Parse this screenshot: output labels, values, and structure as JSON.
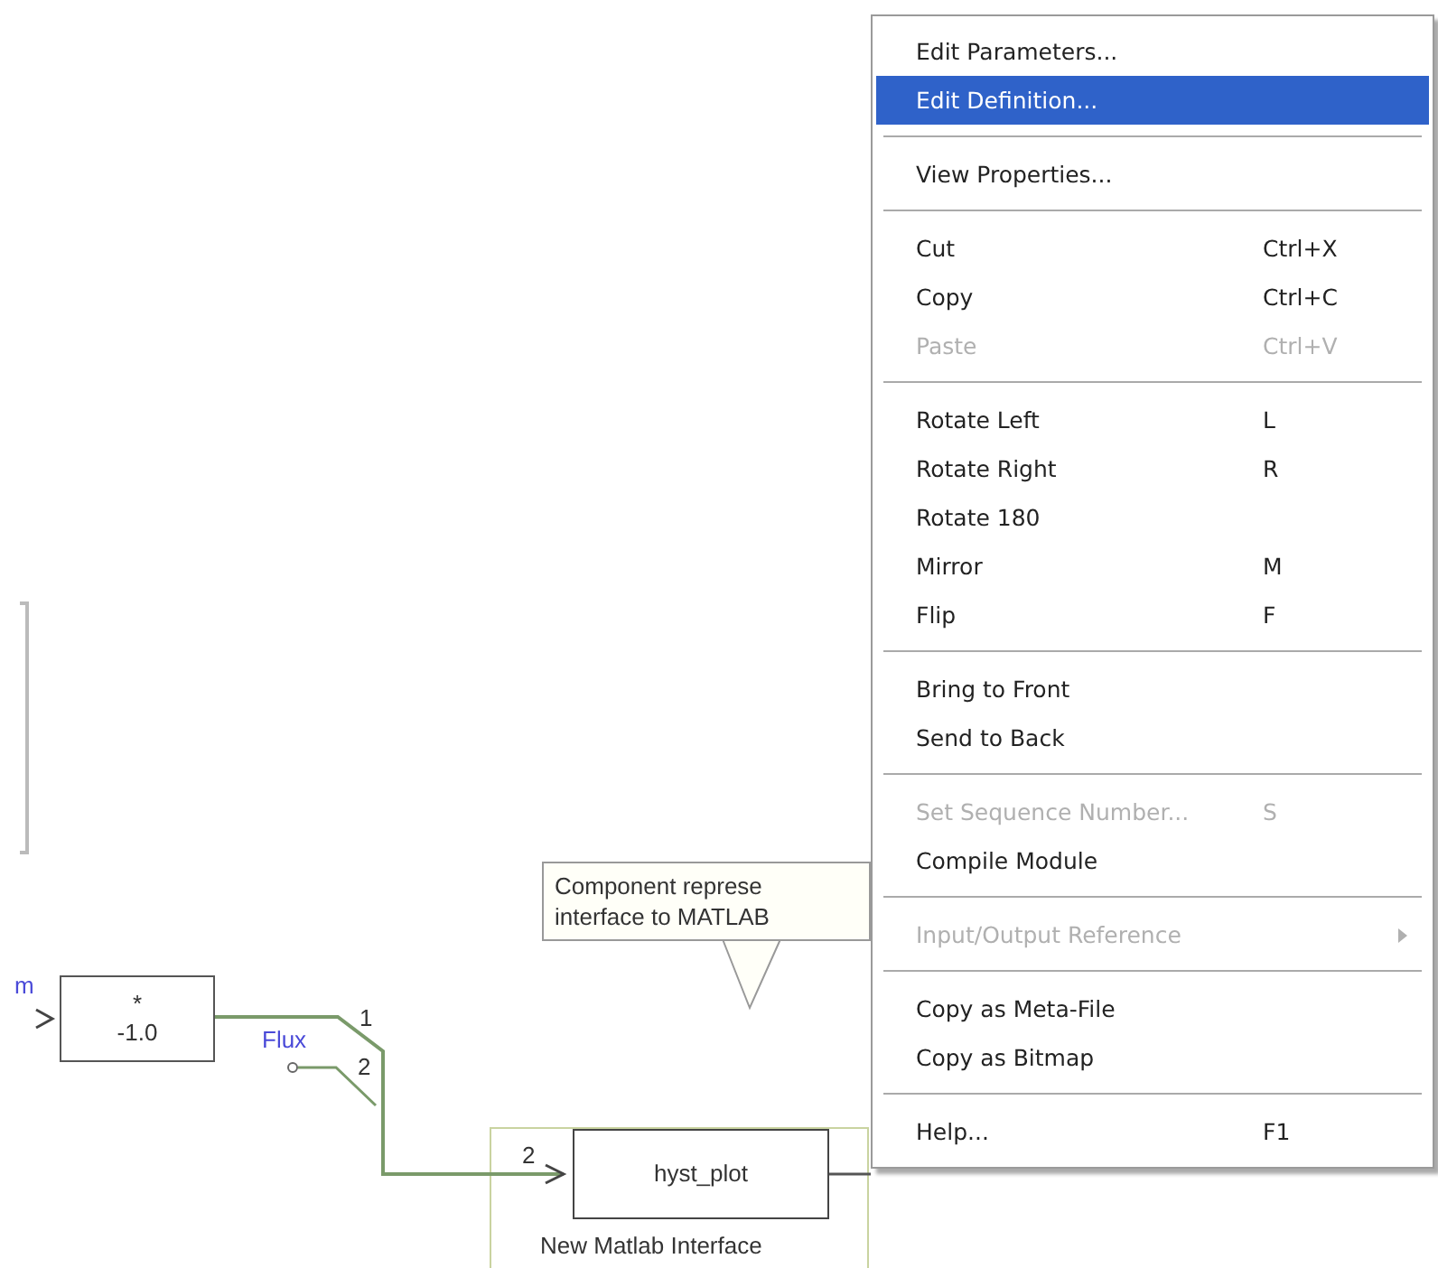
{
  "canvas": {
    "gain_block": {
      "symbol": "*",
      "value": "-1.0"
    },
    "signal_labels": [
      {
        "text": "m"
      },
      {
        "text": "Flux"
      }
    ],
    "switch_ports": [
      "1",
      "2"
    ],
    "matlab_block": {
      "port": "2",
      "name": "hyst_plot",
      "caption": "New Matlab Interface"
    },
    "tooltip": {
      "lines": [
        "Component represe",
        "interface to MATLAB"
      ]
    }
  },
  "context_menu": {
    "items": [
      {
        "kind": "item",
        "label": "Edit Parameters...",
        "selected": false,
        "disabled": false
      },
      {
        "kind": "item",
        "label": "Edit Definition...",
        "selected": true,
        "disabled": false
      },
      {
        "kind": "separator"
      },
      {
        "kind": "item",
        "label": "View Properties...",
        "selected": false,
        "disabled": false
      },
      {
        "kind": "separator"
      },
      {
        "kind": "item",
        "label": "Cut",
        "shortcut": "Ctrl+X",
        "selected": false,
        "disabled": false
      },
      {
        "kind": "item",
        "label": "Copy",
        "shortcut": "Ctrl+C",
        "selected": false,
        "disabled": false
      },
      {
        "kind": "item",
        "label": "Paste",
        "shortcut": "Ctrl+V",
        "selected": false,
        "disabled": true
      },
      {
        "kind": "separator"
      },
      {
        "kind": "item",
        "label": "Rotate Left",
        "shortcut": "L",
        "selected": false,
        "disabled": false
      },
      {
        "kind": "item",
        "label": "Rotate Right",
        "shortcut": "R",
        "selected": false,
        "disabled": false
      },
      {
        "kind": "item",
        "label": "Rotate 180",
        "selected": false,
        "disabled": false
      },
      {
        "kind": "item",
        "label": "Mirror",
        "shortcut": "M",
        "selected": false,
        "disabled": false
      },
      {
        "kind": "item",
        "label": "Flip",
        "shortcut": "F",
        "selected": false,
        "disabled": false
      },
      {
        "kind": "separator"
      },
      {
        "kind": "item",
        "label": "Bring to Front",
        "selected": false,
        "disabled": false
      },
      {
        "kind": "item",
        "label": "Send to Back",
        "selected": false,
        "disabled": false
      },
      {
        "kind": "separator"
      },
      {
        "kind": "item",
        "label": "Set Sequence Number...",
        "shortcut": "S",
        "selected": false,
        "disabled": true
      },
      {
        "kind": "item",
        "label": "Compile Module",
        "selected": false,
        "disabled": false
      },
      {
        "kind": "separator"
      },
      {
        "kind": "item",
        "label": "Input/Output Reference",
        "selected": false,
        "disabled": true,
        "submenu": true
      },
      {
        "kind": "separator"
      },
      {
        "kind": "item",
        "label": "Copy as Meta-File",
        "selected": false,
        "disabled": false
      },
      {
        "kind": "item",
        "label": "Copy as Bitmap",
        "selected": false,
        "disabled": false
      },
      {
        "kind": "separator"
      },
      {
        "kind": "item",
        "label": "Help...",
        "shortcut": "F1",
        "selected": false,
        "disabled": false
      }
    ]
  }
}
